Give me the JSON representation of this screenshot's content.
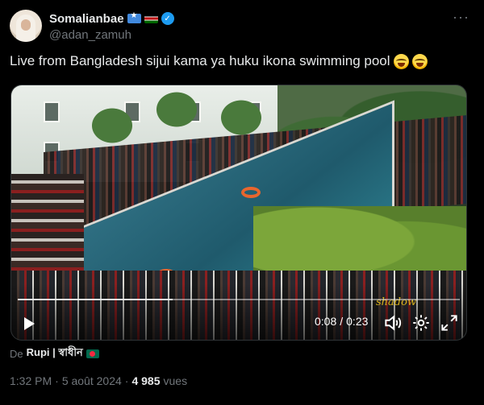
{
  "author": {
    "display_name": "Somalianbae",
    "handle": "@adan_zamuh",
    "flags": [
      "flag-somalia-icon",
      "flag-kenya-icon"
    ],
    "verified": true,
    "verified_color": "#1d9bf0"
  },
  "tweet": {
    "text": "Live from Bangladesh sijui kama ya huku ikona swimming pool",
    "emojis": [
      "face-with-tears-of-joy-icon",
      "face-with-tears-of-joy-icon"
    ]
  },
  "video": {
    "watermark": "shadow",
    "current_time": "0:08",
    "separator": "/",
    "duration": "0:23",
    "progress_fraction": 0.35
  },
  "credit": {
    "prefix": "De",
    "source": "Rupi | স্বাধীন",
    "flag": "flag-bangladesh-icon"
  },
  "meta": {
    "time": "1:32 PM",
    "dot1": "·",
    "date": "5 août 2024",
    "dot2": "·",
    "views_count": "4 985",
    "views_label": "vues"
  },
  "colors": {
    "background": "#000000",
    "text_primary": "#e7e9ea",
    "text_secondary": "#71767b",
    "accent": "#1d9bf0"
  }
}
